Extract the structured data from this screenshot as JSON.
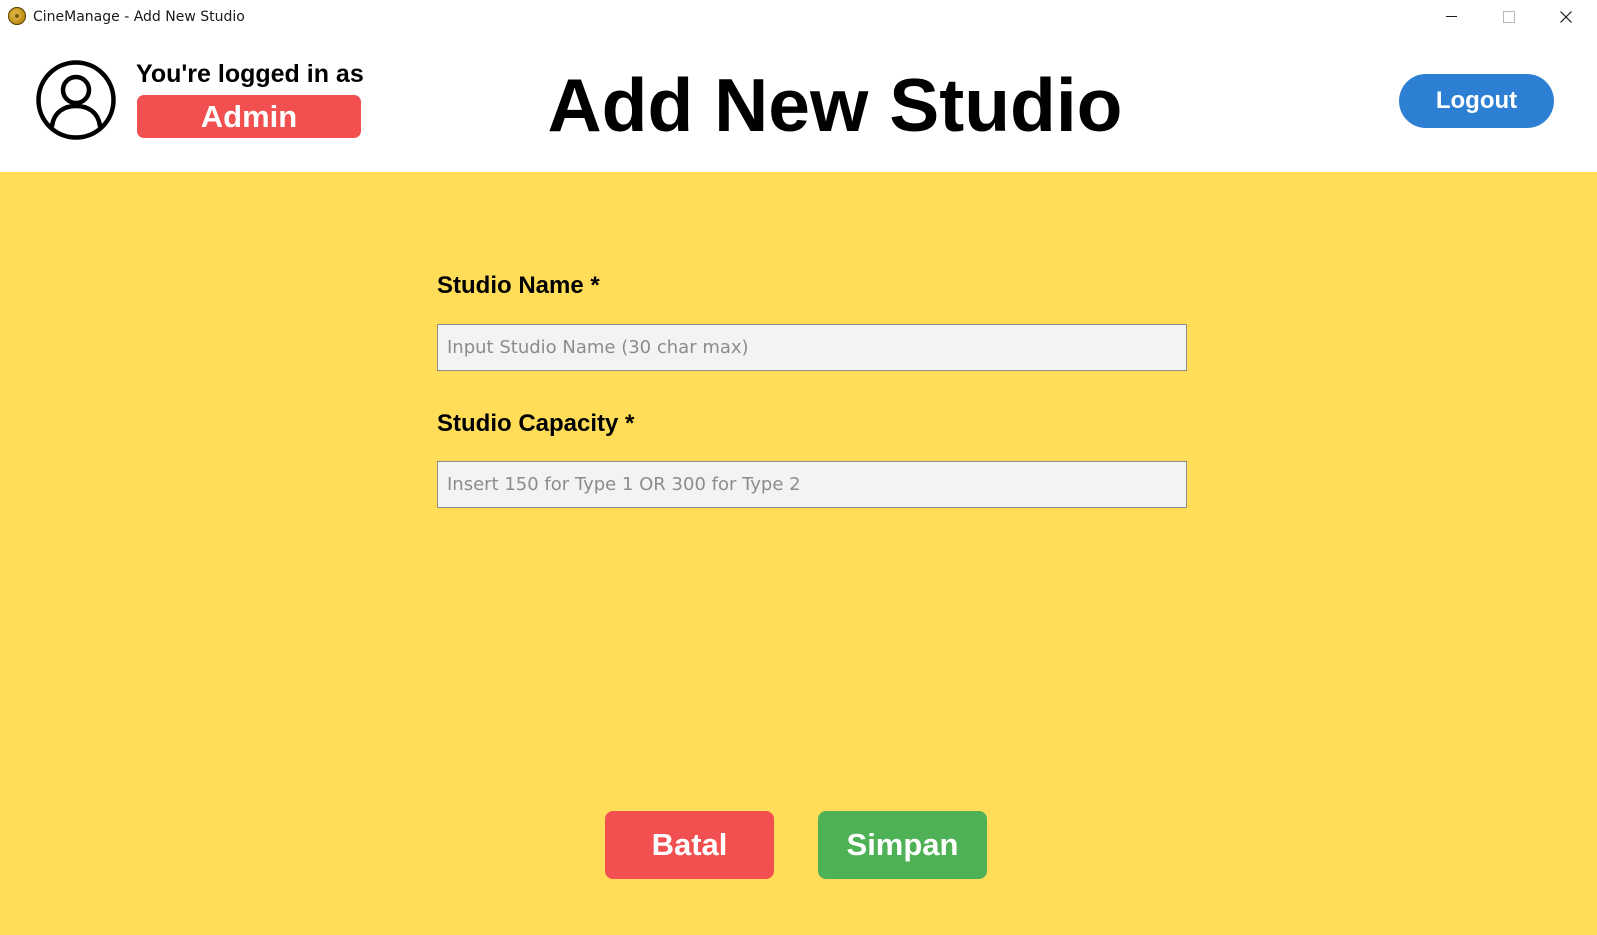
{
  "window": {
    "title": "CineManage - Add New Studio",
    "app_icon": "film-reel-icon",
    "controls": [
      "minimize-icon",
      "maximize-icon",
      "close-icon"
    ]
  },
  "header": {
    "logged_in_text": "You're logged in as",
    "role": "Admin",
    "avatar_icon": "user-circle-icon",
    "title": "Add New Studio",
    "logout_label": "Logout"
  },
  "form": {
    "studio_name": {
      "label": "Studio Name *",
      "placeholder": "Input Studio Name (30 char max)",
      "value": ""
    },
    "studio_capacity": {
      "label": "Studio Capacity *",
      "placeholder": "Insert 150 for Type 1 OR 300 for Type 2",
      "value": ""
    }
  },
  "actions": {
    "cancel_label": "Batal",
    "save_label": "Simpan"
  },
  "colors": {
    "background": "#ffdd59",
    "header_background": "#ffffff",
    "role_badge": "#f25050",
    "logout_button": "#2d7fd4",
    "cancel_button": "#f25050",
    "save_button": "#4fb155"
  }
}
